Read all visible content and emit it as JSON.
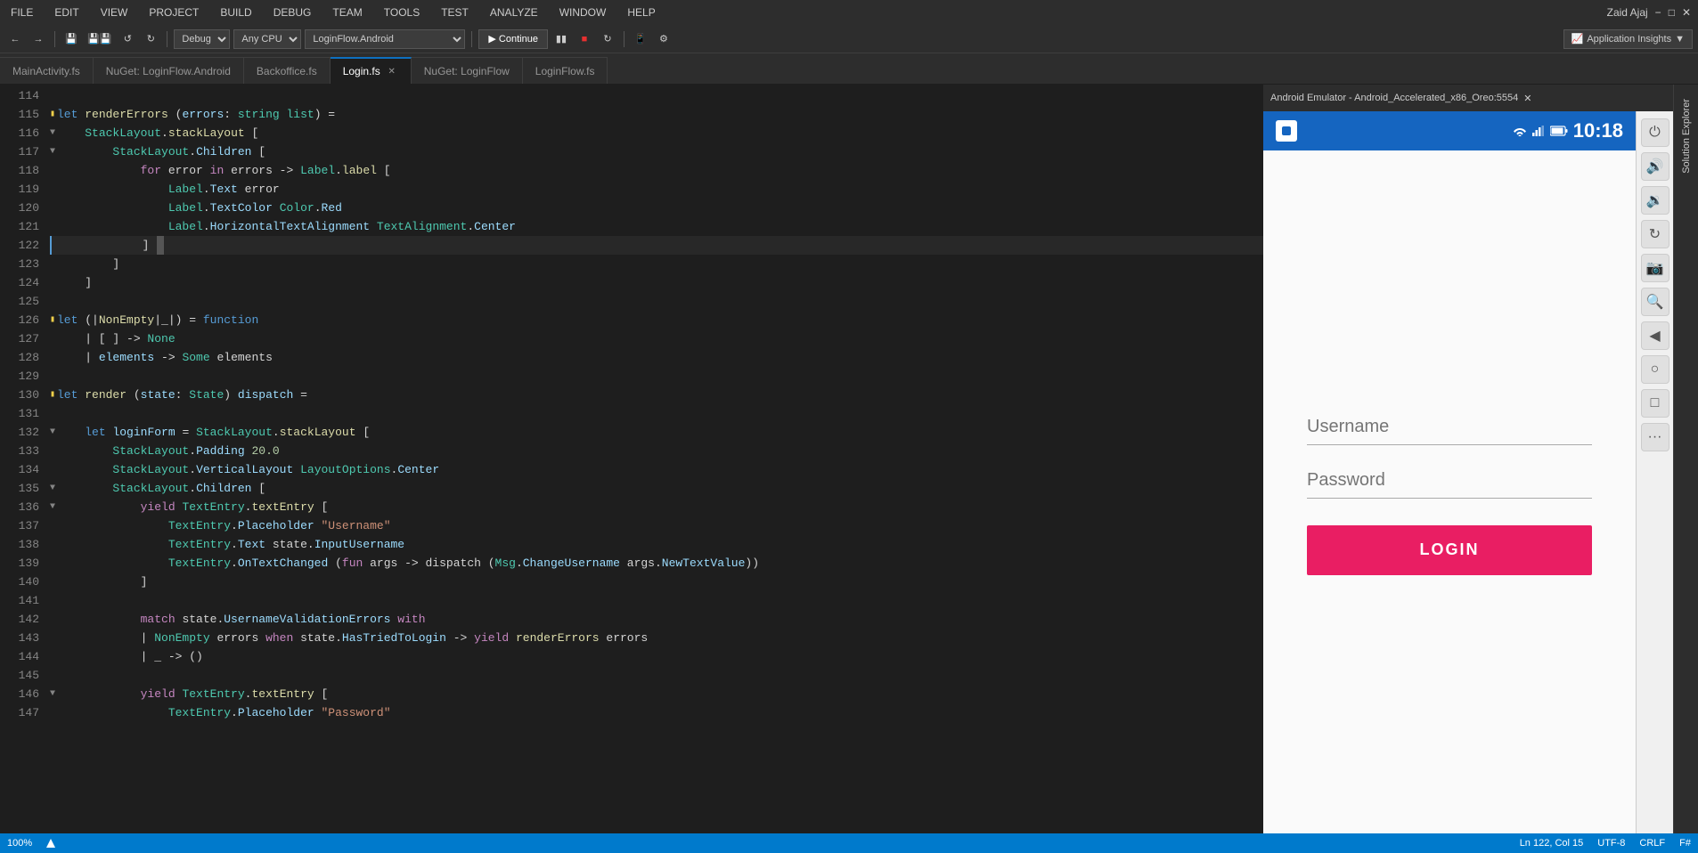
{
  "menubar": {
    "items": [
      "FILE",
      "EDIT",
      "VIEW",
      "PROJECT",
      "BUILD",
      "DEBUG",
      "TEAM",
      "TOOLS",
      "TEST",
      "ANALYZE",
      "WINDOW",
      "HELP"
    ],
    "user": "Zaid Ajaj"
  },
  "toolbar": {
    "debug_mode": "Debug",
    "platform": "Any CPU",
    "project": "LoginFlow.Android",
    "continue_label": "▶ Continue",
    "app_insights": "Application Insights"
  },
  "tabs": [
    {
      "label": "MainActivity.fs",
      "active": false,
      "closable": false
    },
    {
      "label": "NuGet: LoginFlow.Android",
      "active": false,
      "closable": false
    },
    {
      "label": "Backoffice.fs",
      "active": false,
      "closable": false
    },
    {
      "label": "Login.fs",
      "active": true,
      "closable": true
    },
    {
      "label": "NuGet: LoginFlow",
      "active": false,
      "closable": false
    },
    {
      "label": "LoginFlow.fs",
      "active": false,
      "closable": false
    }
  ],
  "code": {
    "lines": [
      {
        "num": "114",
        "content": ""
      },
      {
        "num": "115",
        "content": "let renderErrors (errors: string list) =",
        "type": "normal"
      },
      {
        "num": "116",
        "content": "    StackLayout.stackLayout [",
        "type": "normal"
      },
      {
        "num": "117",
        "content": "        StackLayout.Children [",
        "type": "normal"
      },
      {
        "num": "118",
        "content": "            for error in errors -> Label.label [",
        "type": "normal"
      },
      {
        "num": "119",
        "content": "                Label.Text error",
        "type": "normal"
      },
      {
        "num": "120",
        "content": "                Label.TextColor Color.Red",
        "type": "normal"
      },
      {
        "num": "121",
        "content": "                Label.HorizontalTextAlignment TextAlignment.Center",
        "type": "normal"
      },
      {
        "num": "122",
        "content": "            ]",
        "type": "active"
      },
      {
        "num": "123",
        "content": "        ]",
        "type": "normal"
      },
      {
        "num": "124",
        "content": "    ]",
        "type": "normal"
      },
      {
        "num": "125",
        "content": ""
      },
      {
        "num": "126",
        "content": "let (|NonEmpty|_|) = function",
        "type": "normal"
      },
      {
        "num": "127",
        "content": "    | [ ] -> None",
        "type": "normal"
      },
      {
        "num": "128",
        "content": "    | elements -> Some elements",
        "type": "normal"
      },
      {
        "num": "129",
        "content": ""
      },
      {
        "num": "130",
        "content": "let render (state: State) dispatch =",
        "type": "normal"
      },
      {
        "num": "131",
        "content": ""
      },
      {
        "num": "132",
        "content": "    let loginForm = StackLayout.stackLayout [",
        "type": "normal"
      },
      {
        "num": "133",
        "content": "        StackLayout.Padding 20.0",
        "type": "normal"
      },
      {
        "num": "134",
        "content": "        StackLayout.VerticalLayout LayoutOptions.Center",
        "type": "normal"
      },
      {
        "num": "135",
        "content": "        StackLayout.Children [",
        "type": "normal"
      },
      {
        "num": "136",
        "content": "            yield TextEntry.textEntry [",
        "type": "normal"
      },
      {
        "num": "137",
        "content": "                TextEntry.Placeholder \"Username\"",
        "type": "normal"
      },
      {
        "num": "138",
        "content": "                TextEntry.Text state.InputUsername",
        "type": "normal"
      },
      {
        "num": "139",
        "content": "                TextEntry.OnTextChanged (fun args -> dispatch (Msg.ChangeUsername args.NewTextValue))",
        "type": "normal"
      },
      {
        "num": "140",
        "content": "            ]",
        "type": "normal"
      },
      {
        "num": "141",
        "content": ""
      },
      {
        "num": "142",
        "content": "            match state.UsernameValidationErrors with",
        "type": "normal"
      },
      {
        "num": "143",
        "content": "            | NonEmpty errors when state.HasTriedToLogin -> yield renderErrors errors",
        "type": "normal"
      },
      {
        "num": "144",
        "content": "            | _ -> ()",
        "type": "normal"
      },
      {
        "num": "145",
        "content": ""
      },
      {
        "num": "146",
        "content": "            yield TextEntry.textEntry [",
        "type": "normal"
      },
      {
        "num": "147",
        "content": "                TextEntry.Placeholder \"Password\"",
        "type": "normal"
      }
    ]
  },
  "emulator": {
    "title": "Android Emulator - Android_Accelerated_x86_Oreo:5554",
    "time": "10:18",
    "username_placeholder": "Username",
    "password_placeholder": "Password",
    "login_btn": "LOGIN"
  },
  "solution_explorer": {
    "label": "Solution Explorer"
  },
  "status_bar": {
    "zoom": "100%",
    "caret": "Ln 122, Col 15",
    "encoding": "UTF-8",
    "line_ending": "CRLF",
    "language": "F#"
  }
}
